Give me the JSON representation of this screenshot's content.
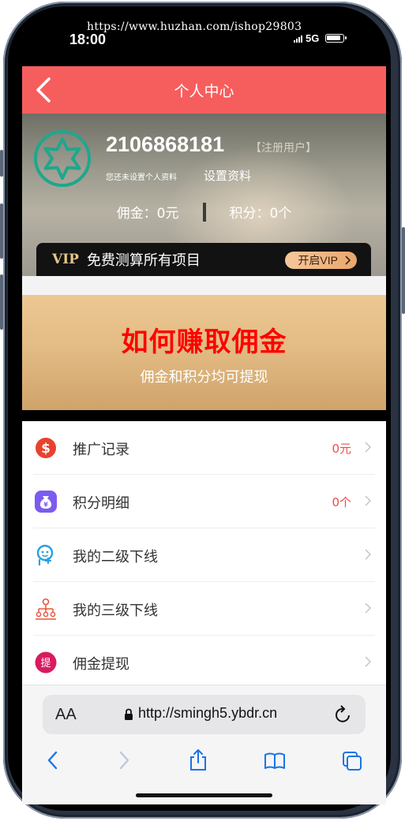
{
  "watermark": "https://www.huzhan.com/ishop29803",
  "status_bar": {
    "time": "18:00",
    "network": "5G"
  },
  "header": {
    "title": "个人中心"
  },
  "user": {
    "id": "2106868181",
    "tag": "【注册用户】",
    "no_profile_text": "您还未设置个人资料",
    "set_profile_label": "设置资料",
    "commission_label": "佣金：",
    "commission_value": "0元",
    "points_label": "积分：",
    "points_value": "0个"
  },
  "vip": {
    "logo": "VIP",
    "text": "免费测算所有项目",
    "button_label": "开启VIP"
  },
  "earn_banner": {
    "title": "如何赚取佣金",
    "subtitle": "佣金和积分均可提现"
  },
  "menu": {
    "items": [
      {
        "label": "推广记录",
        "value": "0元",
        "icon": "dollar-icon",
        "color": "#e8422e"
      },
      {
        "label": "积分明细",
        "value": "0个",
        "icon": "money-bag-icon",
        "color": "#7b5cf0"
      },
      {
        "label": "我的二级下线",
        "value": "",
        "icon": "user-add-icon",
        "color": "#2b9fe0"
      },
      {
        "label": "我的三级下线",
        "value": "",
        "icon": "org-chart-icon",
        "color": "#e8533d"
      },
      {
        "label": "佣金提现",
        "value": "",
        "icon": "withdraw-icon",
        "color": "#d81b60"
      }
    ]
  },
  "browser": {
    "aa_label": "AA",
    "url": "http://smingh5.ybdr.cn"
  },
  "colors": {
    "header": "#f65e5e",
    "accent_red": "#f00",
    "value_red": "#f04a4a",
    "ios_blue": "#1a73e8"
  }
}
